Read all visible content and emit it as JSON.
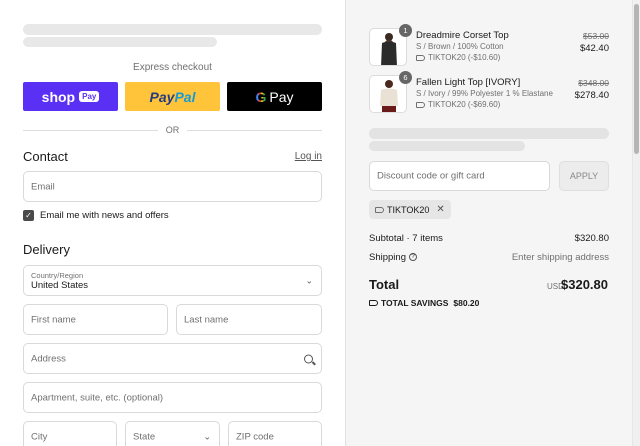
{
  "express": {
    "label": "Express checkout",
    "shop_pay": {
      "brand": "shop",
      "chip": "Pay"
    },
    "paypal": {
      "part1": "Pay",
      "part2": "Pal"
    },
    "gpay": {
      "g": "G",
      "pay": "Pay"
    },
    "or": "OR"
  },
  "contact": {
    "heading": "Contact",
    "login": "Log in",
    "email_placeholder": "Email",
    "newsletter_label": "Email me with news and offers",
    "newsletter_checked": true
  },
  "delivery": {
    "heading": "Delivery",
    "country_label": "Country/Region",
    "country_value": "United States",
    "first_name": "First name",
    "last_name": "Last name",
    "address": "Address",
    "apartment": "Apartment, suite, etc. (optional)",
    "city": "City",
    "state": "State",
    "zip": "ZIP code"
  },
  "cart": {
    "items": [
      {
        "name": "Dreadmire Corset Top",
        "variant": "S / Brown / 100% Cotton",
        "discount": "TIKTOK20 (-$10.60)",
        "old_price": "$53.00",
        "price": "$42.40",
        "qty": "1"
      },
      {
        "name": "Fallen Light Top [IVORY]",
        "variant": "S / Ivory / 99% Polyester 1 % Elastane",
        "discount": "TIKTOK20 (-$69.60)",
        "old_price": "$348.00",
        "price": "$278.40",
        "qty": "6"
      }
    ],
    "discount_placeholder": "Discount code or gift card",
    "apply": "APPLY",
    "applied_code": "TIKTOK20",
    "subtotal_label": "Subtotal · 7 items",
    "subtotal_value": "$320.80",
    "shipping_label": "Shipping",
    "shipping_value": "Enter shipping address",
    "total_label": "Total",
    "total_currency": "USD",
    "total_value": "$320.80",
    "savings_label": "TOTAL SAVINGS",
    "savings_value": "$80.20"
  },
  "colors": {
    "shop_pay": "#5a31f4",
    "paypal": "#ffc439",
    "gpay": "#000000",
    "panel": "#f5f5f5"
  }
}
